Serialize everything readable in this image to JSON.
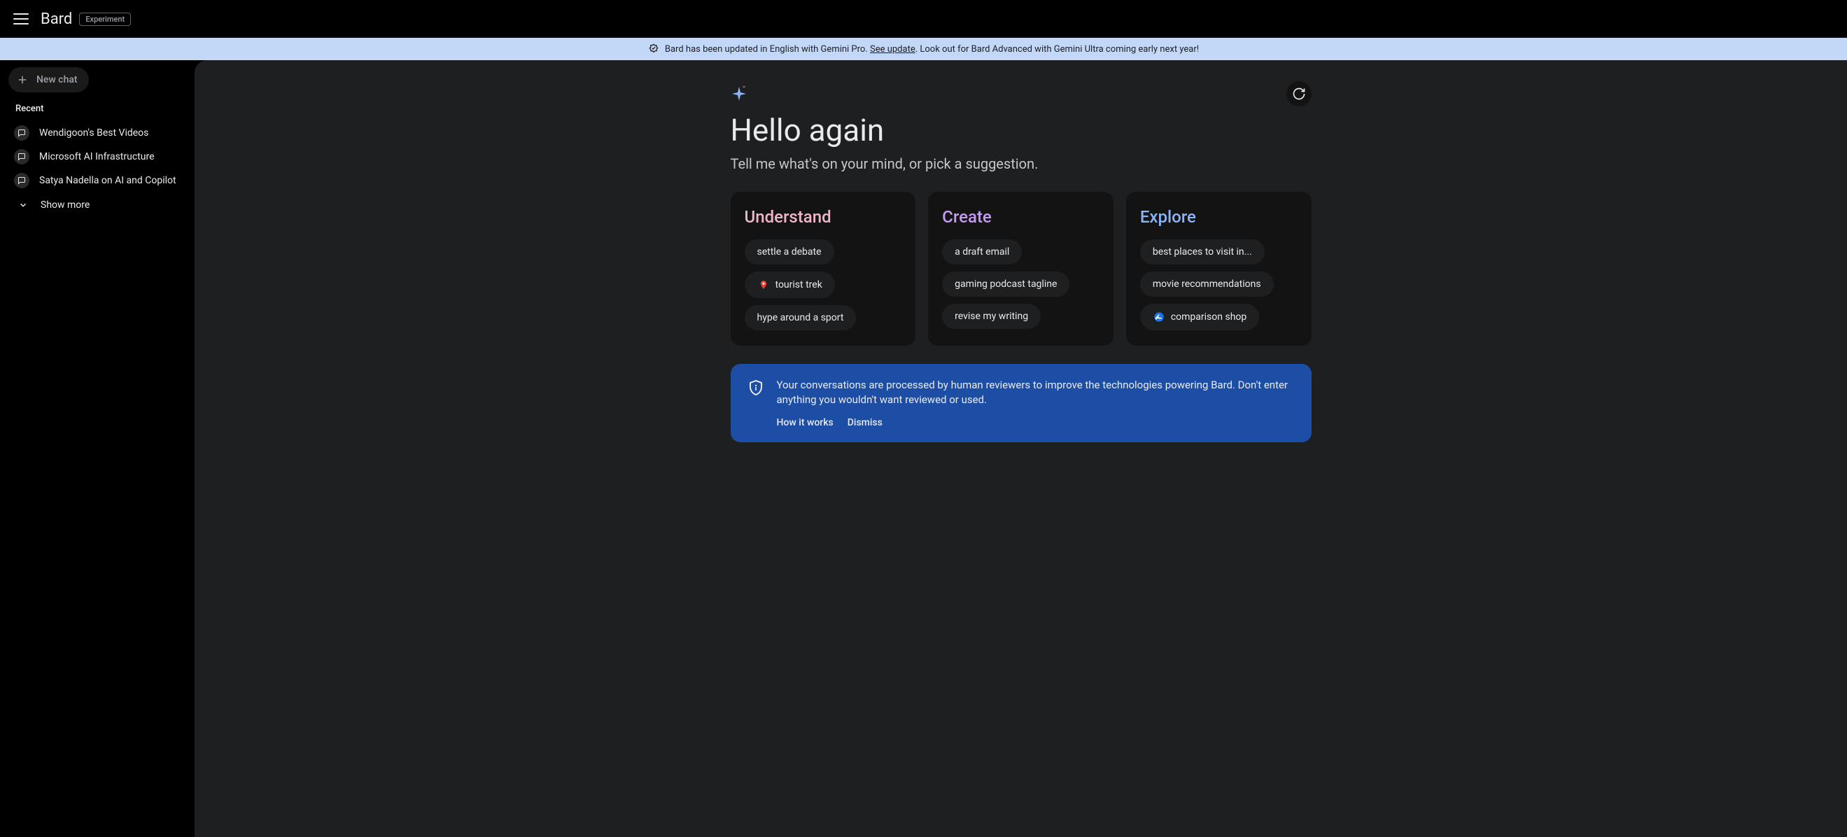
{
  "header": {
    "logo": "Bard",
    "badge": "Experiment"
  },
  "banner": {
    "text1": "Bard has been updated in English with Gemini Pro.",
    "link": "See update",
    "text2": ". Look out for Bard Advanced with Gemini Ultra coming early next year!"
  },
  "sidebar": {
    "new_chat": "New chat",
    "recent_label": "Recent",
    "items": [
      "Wendigoon's Best Videos",
      "Microsoft AI Infrastructure",
      "Satya Nadella on AI and Copilot"
    ],
    "show_more": "Show more"
  },
  "hero": {
    "title": "Hello again",
    "subtitle": "Tell me what's on your mind, or pick a suggestion."
  },
  "cards": {
    "understand": {
      "title": "Understand",
      "chips": [
        {
          "label": "settle a debate"
        },
        {
          "label": "tourist trek",
          "icon": "maps-pin"
        },
        {
          "label": "hype around a sport"
        }
      ]
    },
    "create": {
      "title": "Create",
      "chips": [
        {
          "label": "a draft email"
        },
        {
          "label": "gaming podcast tagline"
        },
        {
          "label": "revise my writing"
        }
      ]
    },
    "explore": {
      "title": "Explore",
      "chips": [
        {
          "label": "best places to visit in..."
        },
        {
          "label": "movie recommendations"
        },
        {
          "label": "comparison shop",
          "icon": "flights"
        }
      ]
    }
  },
  "notice": {
    "text": "Your conversations are processed by human reviewers to improve the technologies powering Bard. Don't enter anything you wouldn't want reviewed or used.",
    "how_it_works": "How it works",
    "dismiss": "Dismiss"
  }
}
